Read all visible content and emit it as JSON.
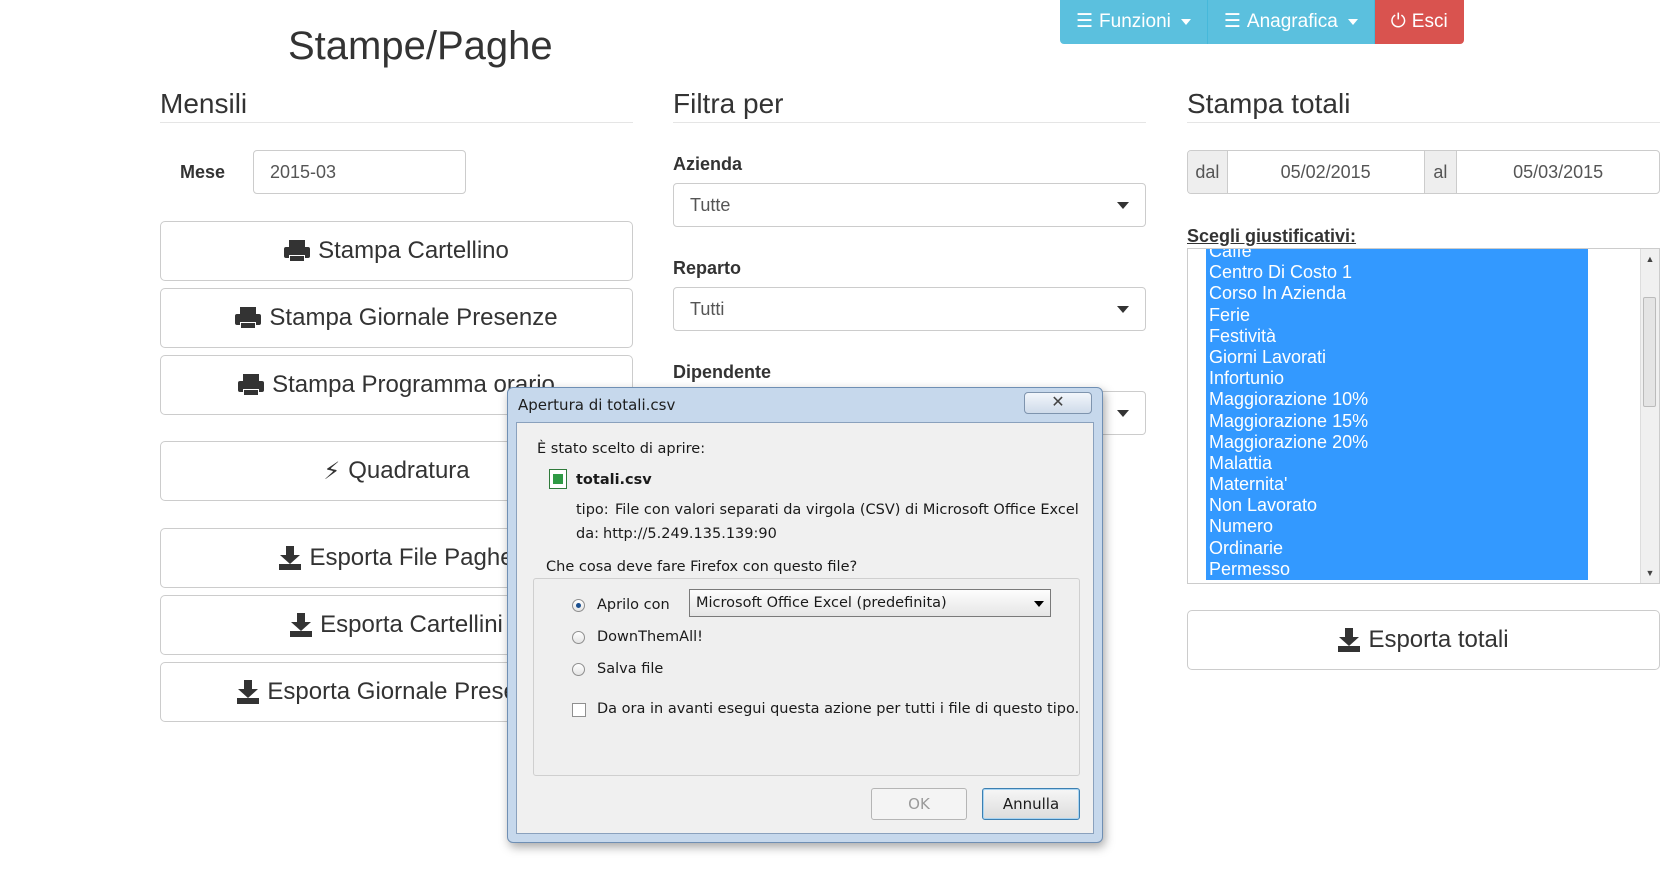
{
  "nav": {
    "funzioni": "Funzioni",
    "anagrafica": "Anagrafica",
    "esci": "Esci"
  },
  "page_title": "Stampe/Paghe",
  "mensili": {
    "title": "Mensili",
    "mese_label": "Mese",
    "mese_value": "2015-03",
    "buttons": {
      "stampa_cartellino": "Stampa Cartellino",
      "stampa_giornale": "Stampa Giornale Presenze",
      "stampa_programma": "Stampa Programma orario",
      "quadratura": "Quadratura",
      "esporta_paghe": "Esporta File Paghe",
      "esporta_cartellini": "Esporta Cartellini",
      "esporta_giornale": "Esporta Giornale Presenze"
    }
  },
  "filtra": {
    "title": "Filtra per",
    "azienda_label": "Azienda",
    "azienda_value": "Tutte",
    "reparto_label": "Reparto",
    "reparto_value": "Tutti",
    "dipendente_label": "Dipendente"
  },
  "totali": {
    "title": "Stampa totali",
    "dal_label": "dal",
    "dal_value": "05/02/2015",
    "al_label": "al",
    "al_value": "05/03/2015",
    "giustificativi_label": "Scegli giustificativi:",
    "giustificativi": [
      "Caffe",
      "Centro Di Costo 1",
      "Corso In Azienda",
      "Ferie",
      "Festività",
      "Giorni Lavorati",
      "Infortunio",
      "Maggiorazione 10%",
      "Maggiorazione 15%",
      "Maggiorazione 20%",
      "Malattia",
      "Maternita'",
      "Non Lavorato",
      "Numero",
      "Ordinarie",
      "Permesso"
    ],
    "esporta": "Esporta totali"
  },
  "dialog": {
    "title": "Apertura di totali.csv",
    "close_glyph": "✕",
    "intro": "È stato scelto di aprire:",
    "filename": "totali.csv",
    "tipo_label": "tipo:",
    "tipo_value": "File con valori separati da virgola (CSV) di Microsoft Office Excel",
    "da_label": "da:",
    "da_value": "http://5.249.135.139:90",
    "question": "Che cosa deve fare Firefox con questo file?",
    "option_open": "Aprilo con",
    "open_app": "Microsoft Office Excel (predefinita)",
    "option_dta": "DownThemAll!",
    "option_save": "Salva file",
    "remember": "Da ora in avanti esegui questa azione per tutti i file di questo tipo.",
    "ok": "OK",
    "cancel": "Annulla"
  },
  "colors": {
    "info": "#5bc0de",
    "danger": "#d9534f",
    "selection": "#3399ff"
  }
}
